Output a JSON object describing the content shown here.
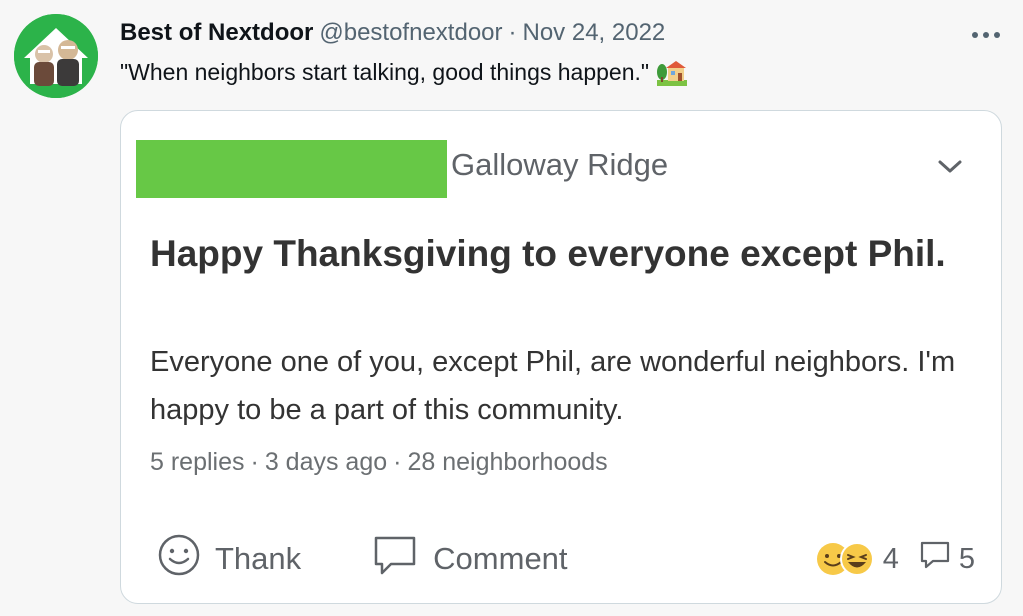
{
  "tweet": {
    "display_name": "Best of Nextdoor",
    "handle": "@bestofnextdoor",
    "separator": "·",
    "date": "Nov 24, 2022",
    "more_icon": "more-horizontal-icon",
    "text": "\"When neighbors start talking, good things happen.\"",
    "emoji": "house-with-garden-emoji"
  },
  "post": {
    "neighborhood": "Galloway Ridge",
    "title": "Happy Thanksgiving to everyone except Phil.",
    "body": "Everyone one of you, except Phil, are wonderful neighbors. I'm happy to be a part of this community.",
    "meta": {
      "replies": "5 replies",
      "sep": "·",
      "time": "3 days ago",
      "reach": "28 neighborhoods"
    },
    "actions": {
      "thank_label": "Thank",
      "comment_label": "Comment"
    },
    "reaction_count": "4",
    "comment_count": "5"
  },
  "colors": {
    "avatar_bg": "#2cb34a",
    "redaction": "#67c846",
    "card_border": "#cfd9de"
  }
}
